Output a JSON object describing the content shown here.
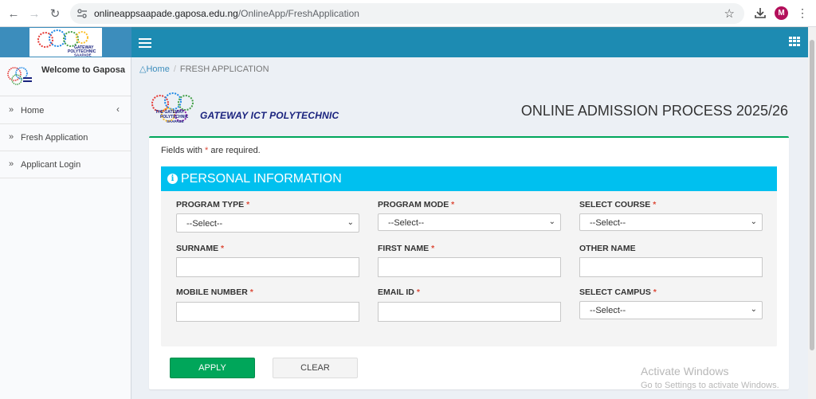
{
  "browser": {
    "url_host": "onlineappsaapade.gaposa.edu.ng",
    "url_path": "/OnlineApp/FreshApplication",
    "profile_initial": "M"
  },
  "sidebar": {
    "welcome": "Welcome to Gaposa",
    "items": [
      {
        "label": "Home"
      },
      {
        "label": "Fresh Application"
      },
      {
        "label": "Applicant Login"
      }
    ]
  },
  "breadcrumb": {
    "home": "Home",
    "current": "FRESH APPLICATION"
  },
  "header": {
    "org_name": "GATEWAY ICT POLYTECHNIC",
    "process_title": "ONLINE ADMISSION PROCESS 2025/26"
  },
  "form": {
    "required_note_prefix": "Fields with ",
    "required_star": "*",
    "required_note_suffix": " are required.",
    "section_title": "PERSONAL INFORMATION",
    "fields": {
      "program_type": {
        "label": "PROGRAM TYPE",
        "value": "--Select--"
      },
      "program_mode": {
        "label": "PROGRAM MODE",
        "value": "--Select--"
      },
      "select_course": {
        "label": "SELECT COURSE",
        "value": "--Select--"
      },
      "surname": {
        "label": "SURNAME",
        "value": ""
      },
      "first_name": {
        "label": "FIRST NAME",
        "value": ""
      },
      "other_name": {
        "label": "OTHER NAME",
        "value": ""
      },
      "mobile_number": {
        "label": "MOBILE NUMBER",
        "value": ""
      },
      "email_id": {
        "label": "EMAIL ID",
        "value": ""
      },
      "select_campus": {
        "label": "SELECT CAMPUS",
        "value": "--Select--"
      }
    },
    "apply_label": "APPLY",
    "clear_label": "CLEAR"
  },
  "watermark": {
    "line1": "Activate Windows",
    "line2": "Go to Settings to activate Windows."
  },
  "colors": {
    "header_blue": "#1d8bb2",
    "info_cyan": "#00c0ef",
    "apply_green": "#00a65a",
    "required_red": "#dd4b39"
  }
}
